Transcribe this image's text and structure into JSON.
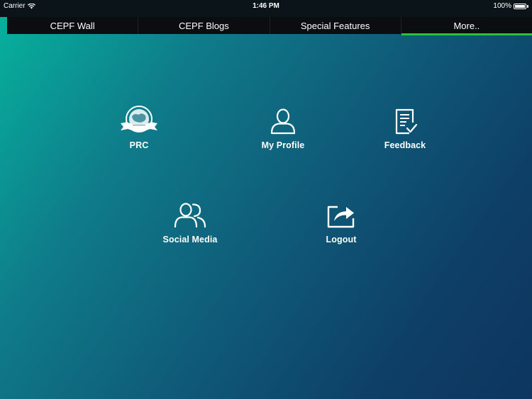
{
  "status_bar": {
    "carrier": "Carrier",
    "time": "1:46 PM",
    "battery": "100%"
  },
  "tabs": [
    {
      "label": "CEPF Wall",
      "active": false
    },
    {
      "label": "CEPF Blogs",
      "active": false
    },
    {
      "label": "Special Features",
      "active": false
    },
    {
      "label": "More..",
      "active": true
    }
  ],
  "menu": {
    "items": [
      {
        "label": "PRC",
        "icon": "prc-logo-icon"
      },
      {
        "label": "My Profile",
        "icon": "user-icon"
      },
      {
        "label": "Feedback",
        "icon": "checklist-icon"
      },
      {
        "label": "Social Media",
        "icon": "users-icon"
      },
      {
        "label": "Logout",
        "icon": "share-out-icon"
      }
    ]
  },
  "colors": {
    "accent_green": "#2bc23b",
    "tab_bg": "#0b0d10",
    "gradient_start": "#06b39e",
    "gradient_end": "#0d355f"
  }
}
